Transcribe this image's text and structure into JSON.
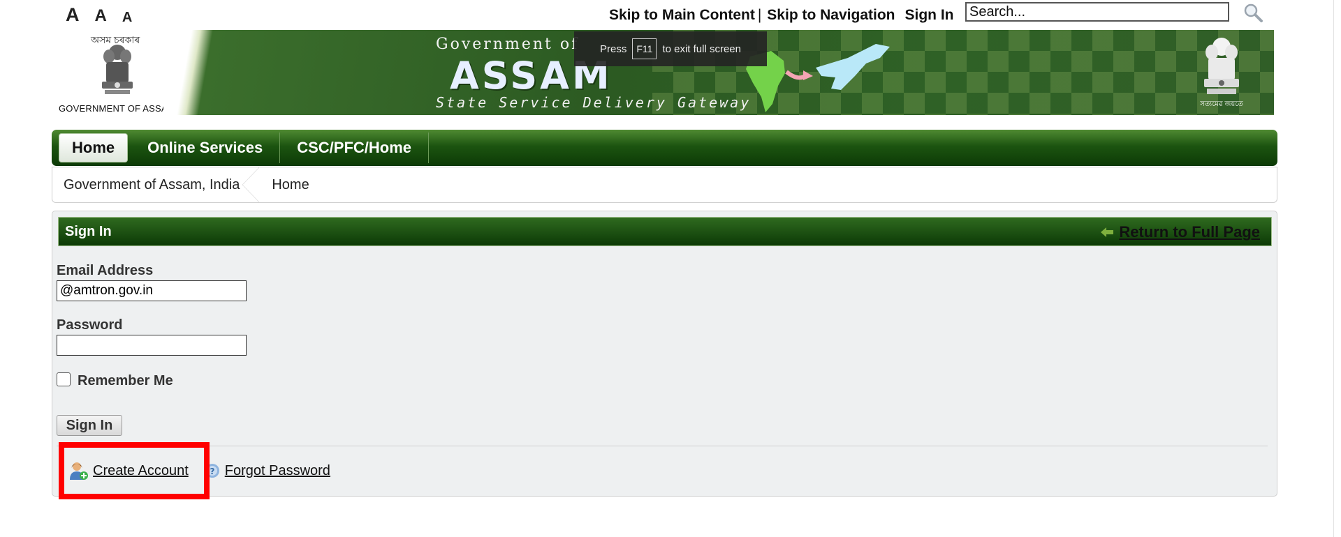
{
  "font_size_controls": [
    "A",
    "A",
    "A"
  ],
  "top_links": {
    "skip_main": "Skip to Main Content",
    "separator": "|",
    "skip_nav": "Skip to Navigation",
    "sign_in": "Sign In"
  },
  "search": {
    "placeholder": "Search..."
  },
  "header": {
    "assamese_text": "অসম চৰকাৰ",
    "gov_caption": "GOVERNMENT OF ASSAM",
    "gov_of": "Government of",
    "state": "ASSAM",
    "tagline": "State Service Delivery Gateway",
    "motto": "সত্যমেৱ জয়তে"
  },
  "fullscreen_notice": {
    "press": "Press",
    "key": "F11",
    "rest": "to exit full screen"
  },
  "nav": {
    "tabs": [
      "Home",
      "Online Services",
      "CSC/PFC/Home"
    ]
  },
  "breadcrumb": [
    "Government of Assam, India",
    "Home"
  ],
  "signin_panel": {
    "title": "Sign In",
    "return_link": "Return to Full Page",
    "email_label": "Email Address",
    "email_value": "@amtron.gov.in",
    "password_label": "Password",
    "password_value": "",
    "remember_label": "Remember Me",
    "submit_label": "Sign In",
    "create_account": "Create Account",
    "forgot_password": "Forgot Password"
  },
  "colors": {
    "nav_green": "#1c5410",
    "highlight": "#ff0000"
  }
}
